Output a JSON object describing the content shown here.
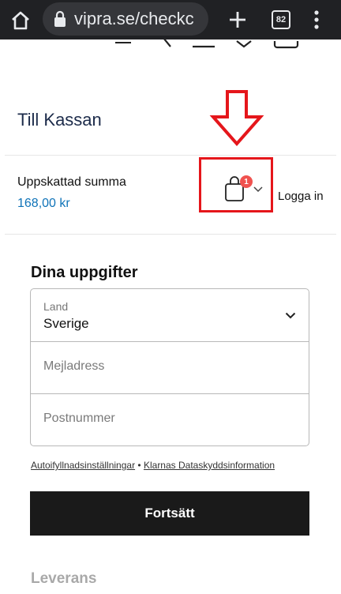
{
  "browser": {
    "url": "vipra.se/checkc",
    "tab_count": "82"
  },
  "page": {
    "title": "Till Kassan",
    "summary_label": "Uppskattad summa",
    "summary_value": "168,00 kr",
    "cart_count": "1",
    "login_label": "Logga in"
  },
  "form": {
    "section_title": "Dina uppgifter",
    "land_label": "Land",
    "land_value": "Sverige",
    "email_placeholder": "Mejladress",
    "postcode_placeholder": "Postnummer",
    "link_autofill": "Autoifyllnadsinställningar",
    "link_separator": "•",
    "link_privacy": "Klarnas Dataskyddsinformation",
    "submit_label": "Fortsätt"
  },
  "next_section": "Leverans",
  "colors": {
    "chrome_bg": "#202124",
    "accent_price": "#0f73b8",
    "annotation_red": "#e5161b",
    "badge": "#f0524f",
    "cta_bg": "#1a1a1a"
  },
  "icons": [
    "home-icon",
    "lock-icon",
    "plus-icon",
    "tab-switcher-icon",
    "more-vert-icon",
    "shopping-bag-icon",
    "chevron-down-icon",
    "down-arrow-annotation"
  ]
}
